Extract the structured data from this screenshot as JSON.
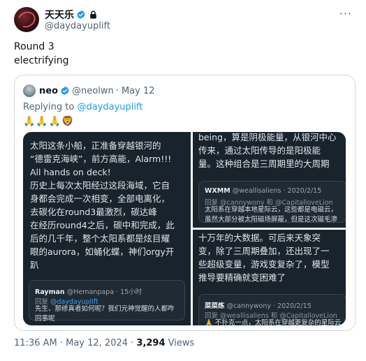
{
  "author": {
    "name": "天天乐",
    "handle": "@daydayuplift"
  },
  "tweet": {
    "line1": "Round 3",
    "line2": "electrifying"
  },
  "quote": {
    "name": "neo",
    "handle": "@neolwn",
    "date": "· May 12",
    "reply_prefix": "Replying to ",
    "reply_to": "@daydayuplift",
    "emojis": "🙏🙏🙏🦁",
    "image_left": {
      "text": [
        "太阳这条小船，正准备穿越银河的",
        "“德雷克海峡”，前方高能，Alarm!!!",
        "All hands on deck!",
        "历史上每次太阳经过这段海域，它自",
        "身都会完成一次相变，全部电离化，",
        "去碳化在round3最激烈，碳达峰",
        "在经历round4之后，碳中和完成，此",
        "后的几千年，整个太阳系都是炫目耀",
        "眼的aurora，如蛹化蝶，神们orgy开",
        "趴"
      ],
      "sub": {
        "user": "Rayman",
        "handle": "@Hemanpapa · 15小时",
        "reply": "回复 ",
        "reply_to": "@daydayuplift",
        "text": [
          "先生、那修真者如何呢？我们元神觉醒的人都咋",
          "回事呢"
        ]
      }
    },
    "image_right_top": {
      "text": [
        "being，算是阴极能量，从银河中心",
        "传来，通过太阳传导的是阳极能",
        "量。这种组合是三周期里的大周期"
      ],
      "sub": {
        "user": "WXMM",
        "handle": "@weallisaliens · 2020/2/15",
        "reply": "回复 @cannywony 和 @CapitalloveLion",
        "text": [
          "太阳系在穿越本地星际云，这些都是电磁云，",
          "虽然大部分被太阳磁场屏蔽，但是这次磁毛渗"
        ]
      }
    },
    "image_right_bottom": {
      "text": [
        "十万年的大数据。可后来天象突",
        "变，除了三周期叠加，还出现了一",
        "些超级变量，游戏变复杂了，模型",
        "推导要精确就变困难了"
      ],
      "sub": {
        "user": "菜菜炼",
        "handle": "@cannywony · 2020/2/15",
        "reply": "回复 @weallisaliens 和 @CapitalloveLion",
        "text": [
          "🙏 不扑克一点，太阳系在穿越更复杂的星际云"
        ]
      }
    }
  },
  "footer": {
    "time": "11:36 AM · May 12, 2024 · ",
    "views": "3,294",
    "views_label": " Views"
  },
  "colors": {
    "verified": "#1d9bf0",
    "link": "#1d9bf0",
    "image_bg": "#19232c"
  },
  "icons": [
    "verified-badge-icon",
    "lock-icon",
    "more-icon"
  ]
}
